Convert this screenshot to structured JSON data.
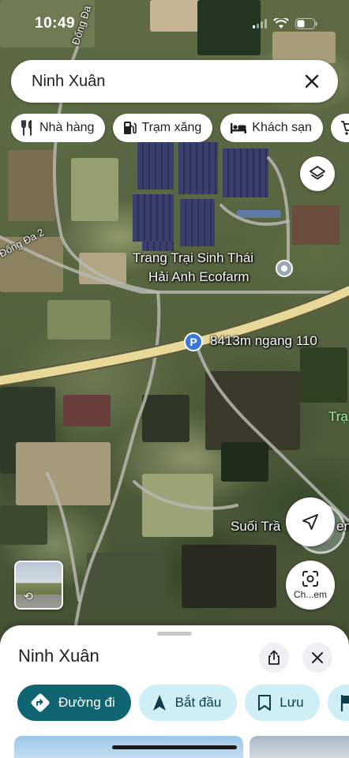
{
  "status_bar": {
    "time": "10:49"
  },
  "search": {
    "query": "Ninh Xuân"
  },
  "chips": [
    {
      "label": "Nhà hàng",
      "icon": "fork-knife-icon"
    },
    {
      "label": "Trạm xăng",
      "icon": "gas-pump-icon"
    },
    {
      "label": "Khách sạn",
      "icon": "bed-icon"
    },
    {
      "label": "",
      "icon": "cart-icon"
    }
  ],
  "map": {
    "place_label_line1": "Trang Trại Sinh Thái",
    "place_label_line2": "Hải Anh Ecofarm",
    "parking_label": "8413m ngang 110",
    "parking_glyph": "P",
    "road_label_top": "Đống Đa",
    "road_label_left": "Đống Đa 2",
    "green_label": "Trạ",
    "stream_label": "Suối Trầ",
    "stream_label_tail": "en"
  },
  "lens": {
    "label": "Ch...em"
  },
  "sheet": {
    "title": "Ninh Xuân",
    "actions": [
      {
        "label": "Đường đi",
        "icon": "directions-icon",
        "style": "primary"
      },
      {
        "label": "Bắt đầu",
        "icon": "navigation-arrow-icon",
        "style": "secondary"
      },
      {
        "label": "Lưu",
        "icon": "bookmark-icon",
        "style": "secondary"
      },
      {
        "label": "",
        "icon": "flag-icon",
        "style": "secondary"
      }
    ]
  },
  "colors": {
    "primary_action": "#0f6672",
    "secondary_action": "#cdeff5",
    "parking_pin": "#3b79d9",
    "highway": "#e8d99a"
  }
}
